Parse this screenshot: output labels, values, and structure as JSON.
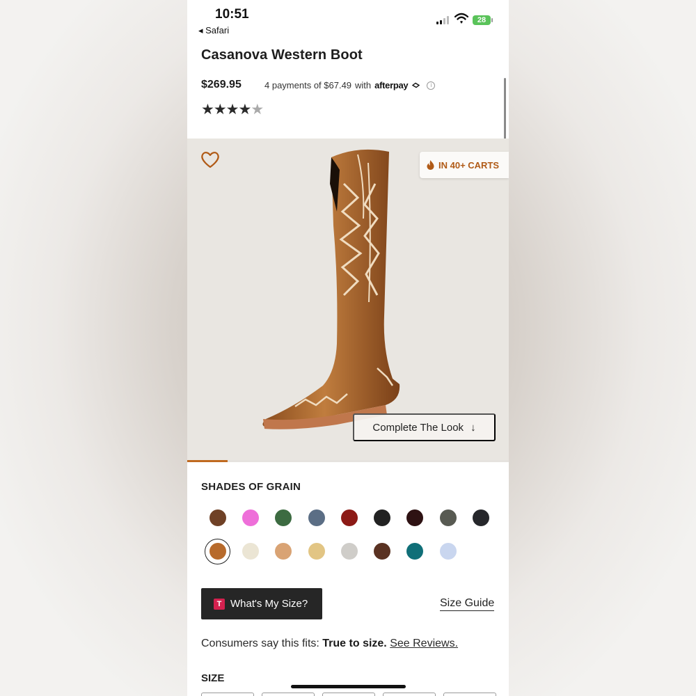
{
  "status_bar": {
    "time": "10:51",
    "back_app": "◂ Safari",
    "battery": "28"
  },
  "product": {
    "title": "Casanova Western Boot",
    "price": "$269.95",
    "payments_text": "4 payments of $67.49",
    "payments_with": "with",
    "afterpay_brand": "afterpay",
    "rating_stars": "★★★★",
    "rating_half": "★",
    "rating": 4.5
  },
  "hero": {
    "carts_badge": "IN 40+ CARTS",
    "complete_look": "Complete The Look",
    "arrow": "↓",
    "gallery_progress": 0.125
  },
  "shades": {
    "heading": "SHADES OF GRAIN",
    "row1": [
      "#6f4126",
      "#ee6fd9",
      "#3c6b41",
      "#5b6e85",
      "#8c1a16",
      "#222222",
      "#2e1213",
      "#585a52",
      "#26272b"
    ],
    "row2": [
      "#b76a2b",
      "#ebe5d4",
      "#d9a374",
      "#e2c584",
      "#cfcdc9",
      "#5a3222",
      "#106f78",
      "#c9d6ef"
    ],
    "selected": "#b76a2b"
  },
  "size_tools": {
    "quiz_badge": "T",
    "quiz_label": "What's My Size?",
    "guide_label": "Size Guide"
  },
  "fit": {
    "prefix": "Consumers say this fits:",
    "value": "True to size.",
    "link": "See Reviews."
  },
  "size": {
    "heading": "SIZE"
  },
  "colors": {
    "accent": "#b05a16",
    "progress": "#c06a20",
    "dark_button": "#262626"
  }
}
